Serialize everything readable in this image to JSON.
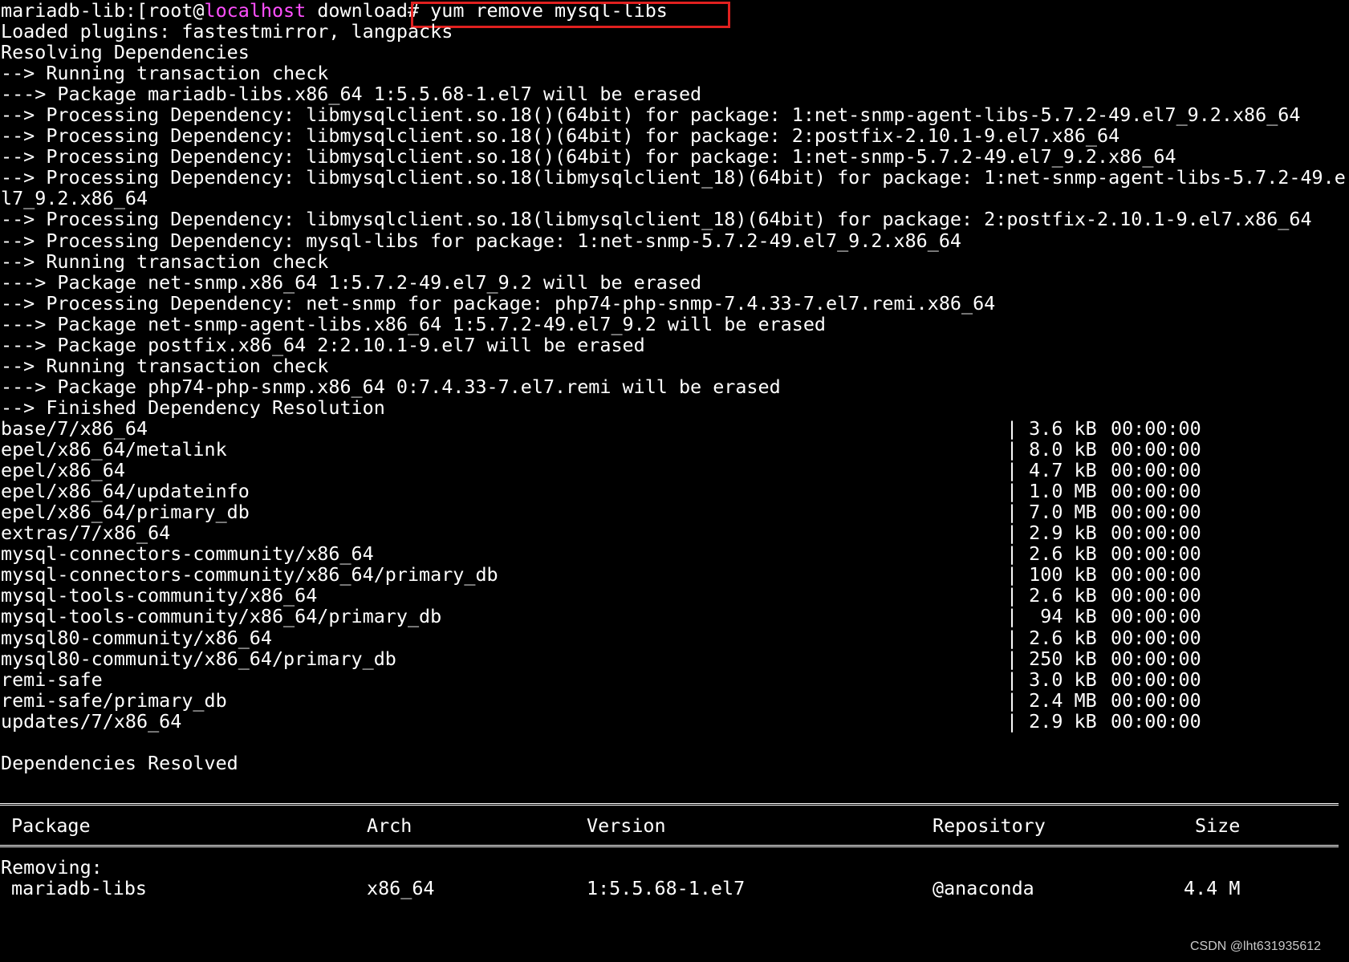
{
  "terminal": {
    "prompt": {
      "prefix": "mariadb-lib:[root@",
      "host": "localhost",
      "cwd": " download",
      "command": "# yum remove mysql-libs"
    },
    "log_lines": [
      "Loaded plugins: fastestmirror, langpacks",
      "Resolving Dependencies",
      "--> Running transaction check",
      "---> Package mariadb-libs.x86_64 1:5.5.68-1.el7 will be erased",
      "--> Processing Dependency: libmysqlclient.so.18()(64bit) for package: 1:net-snmp-agent-libs-5.7.2-49.el7_9.2.x86_64",
      "--> Processing Dependency: libmysqlclient.so.18()(64bit) for package: 2:postfix-2.10.1-9.el7.x86_64",
      "--> Processing Dependency: libmysqlclient.so.18()(64bit) for package: 1:net-snmp-5.7.2-49.el7_9.2.x86_64",
      "--> Processing Dependency: libmysqlclient.so.18(libmysqlclient_18)(64bit) for package: 1:net-snmp-agent-libs-5.7.2-49.e",
      "l7_9.2.x86_64",
      "--> Processing Dependency: libmysqlclient.so.18(libmysqlclient_18)(64bit) for package: 2:postfix-2.10.1-9.el7.x86_64",
      "--> Processing Dependency: mysql-libs for package: 1:net-snmp-5.7.2-49.el7_9.2.x86_64",
      "--> Running transaction check",
      "---> Package net-snmp.x86_64 1:5.7.2-49.el7_9.2 will be erased",
      "--> Processing Dependency: net-snmp for package: php74-php-snmp-7.4.33-7.el7.remi.x86_64",
      "---> Package net-snmp-agent-libs.x86_64 1:5.7.2-49.el7_9.2 will be erased",
      "---> Package postfix.x86_64 2:2.10.1-9.el7 will be erased",
      "--> Running transaction check",
      "---> Package php74-php-snmp.x86_64 0:7.4.33-7.el7.remi will be erased",
      "--> Finished Dependency Resolution"
    ],
    "repos": [
      {
        "name": "base/7/x86_64",
        "size": "| 3.6 kB",
        "time": "00:00:00"
      },
      {
        "name": "epel/x86_64/metalink",
        "size": "| 8.0 kB",
        "time": "00:00:00"
      },
      {
        "name": "epel/x86_64",
        "size": "| 4.7 kB",
        "time": "00:00:00"
      },
      {
        "name": "epel/x86_64/updateinfo",
        "size": "| 1.0 MB",
        "time": "00:00:00"
      },
      {
        "name": "epel/x86_64/primary_db",
        "size": "| 7.0 MB",
        "time": "00:00:00"
      },
      {
        "name": "extras/7/x86_64",
        "size": "| 2.9 kB",
        "time": "00:00:00"
      },
      {
        "name": "mysql-connectors-community/x86_64",
        "size": "| 2.6 kB",
        "time": "00:00:00"
      },
      {
        "name": "mysql-connectors-community/x86_64/primary_db",
        "size": "| 100 kB",
        "time": "00:00:00"
      },
      {
        "name": "mysql-tools-community/x86_64",
        "size": "| 2.6 kB",
        "time": "00:00:00"
      },
      {
        "name": "mysql-tools-community/x86_64/primary_db",
        "size": "|  94 kB",
        "time": "00:00:00"
      },
      {
        "name": "mysql80-community/x86_64",
        "size": "| 2.6 kB",
        "time": "00:00:00"
      },
      {
        "name": "mysql80-community/x86_64/primary_db",
        "size": "| 250 kB",
        "time": "00:00:00"
      },
      {
        "name": "remi-safe",
        "size": "| 3.0 kB",
        "time": "00:00:00"
      },
      {
        "name": "remi-safe/primary_db",
        "size": "| 2.4 MB",
        "time": "00:00:00"
      },
      {
        "name": "updates/7/x86_64",
        "size": "| 2.9 kB",
        "time": "00:00:00"
      }
    ],
    "resolved_text": "Dependencies Resolved",
    "table": {
      "headers": {
        "package": "Package",
        "arch": "Arch",
        "version": "Version",
        "repository": "Repository",
        "size": "Size"
      },
      "section_label": "Removing:",
      "row": {
        "package": "mariadb-libs",
        "arch": "x86_64",
        "version": "1:5.5.68-1.el7",
        "repository": "@anaconda",
        "size": "4.4 M"
      }
    },
    "highlight_color": "#e0201f",
    "host_color": "#ff4fff"
  },
  "watermark": "CSDN @lht631935612"
}
